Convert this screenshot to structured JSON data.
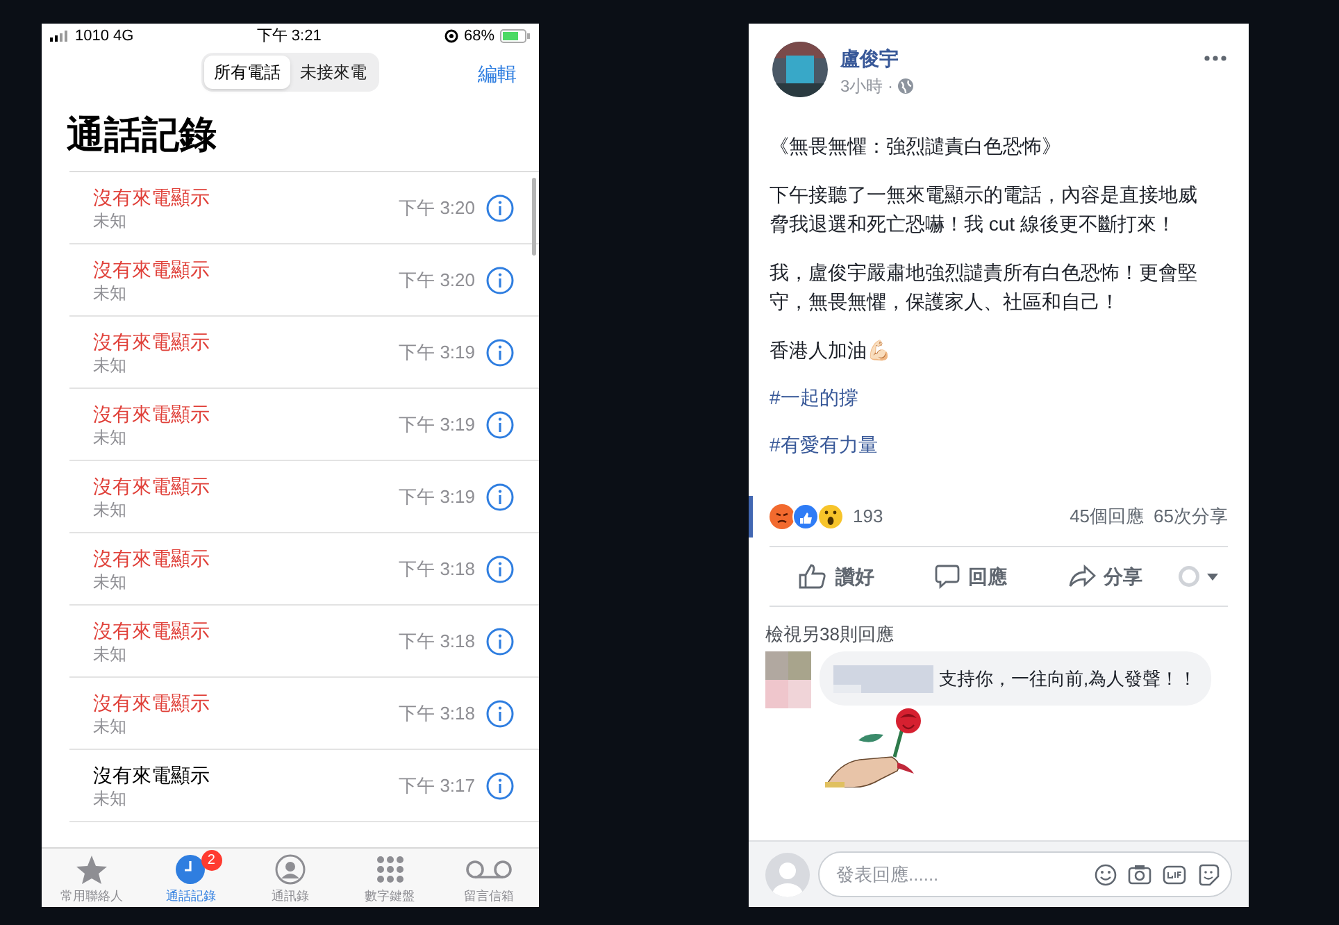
{
  "phone": {
    "status_bar": {
      "carrier": "1010 4G",
      "time": "下午 3:21",
      "battery": "68%"
    },
    "segments": [
      {
        "label": "所有電話",
        "selected": true
      },
      {
        "label": "未接來電",
        "selected": false
      }
    ],
    "edit": "編輯",
    "title": "通話記錄",
    "calls": [
      {
        "name": "沒有來電顯示",
        "detail": "未知",
        "time": "下午 3:20",
        "missed": true
      },
      {
        "name": "沒有來電顯示",
        "detail": "未知",
        "time": "下午 3:20",
        "missed": true
      },
      {
        "name": "沒有來電顯示",
        "detail": "未知",
        "time": "下午 3:19",
        "missed": true
      },
      {
        "name": "沒有來電顯示",
        "detail": "未知",
        "time": "下午 3:19",
        "missed": true
      },
      {
        "name": "沒有來電顯示",
        "detail": "未知",
        "time": "下午 3:19",
        "missed": true
      },
      {
        "name": "沒有來電顯示",
        "detail": "未知",
        "time": "下午 3:18",
        "missed": true
      },
      {
        "name": "沒有來電顯示",
        "detail": "未知",
        "time": "下午 3:18",
        "missed": true
      },
      {
        "name": "沒有來電顯示",
        "detail": "未知",
        "time": "下午 3:18",
        "missed": true
      },
      {
        "name": "沒有來電顯示",
        "detail": "未知",
        "time": "下午 3:17",
        "missed": false
      }
    ],
    "tabs": [
      {
        "label": "常用聯絡人",
        "selected": false
      },
      {
        "label": "通話記錄",
        "selected": true,
        "badge": "2"
      },
      {
        "label": "通訊錄",
        "selected": false
      },
      {
        "label": "數字鍵盤",
        "selected": false
      },
      {
        "label": "留言信箱",
        "selected": false
      }
    ]
  },
  "post": {
    "author": "盧俊宇",
    "time": "3小時 ·",
    "paragraphs": [
      {
        "text": "《無畏無懼：強烈譴責白色恐怖》",
        "kind": "text"
      },
      {
        "text": "下午接聽了一無來電顯示的電話，內容是直接地威脅我退選和死亡恐嚇！我 cut 線後更不斷打來！",
        "kind": "text"
      },
      {
        "text": "我，盧俊宇嚴肅地強烈譴責所有白色恐怖！更會堅守，無畏無懼，保護家人、社區和自己！",
        "kind": "text"
      },
      {
        "text": "香港人加油💪🏻",
        "kind": "text"
      },
      {
        "text": "#一起的撐",
        "kind": "hashtag"
      },
      {
        "text": "#有愛有力量",
        "kind": "hashtag"
      }
    ],
    "reactions": {
      "count": "193",
      "comments": "45個回應",
      "shares": "65次分享"
    },
    "actions": [
      {
        "label": "讚好"
      },
      {
        "label": "回應"
      },
      {
        "label": "分享"
      }
    ],
    "view_more": "檢視另38則回應",
    "comment": {
      "text": "支持你，一往向前,為人發聲！！"
    },
    "reply_box": {
      "placeholder": "發表回應......"
    }
  }
}
